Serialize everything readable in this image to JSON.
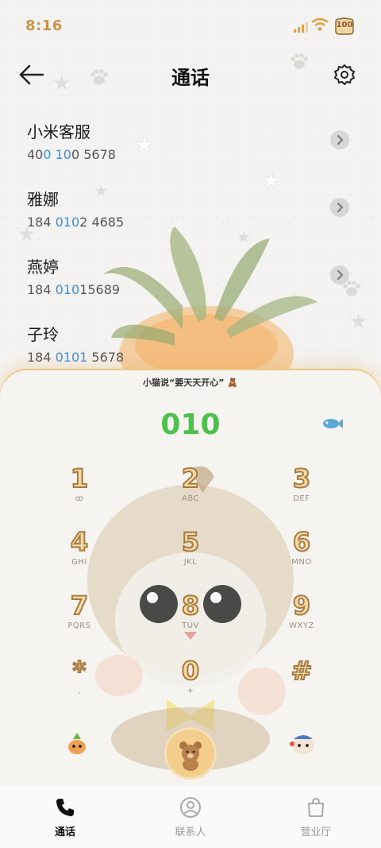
{
  "status_bar": {
    "time": "8:16",
    "battery": "100"
  },
  "header": {
    "title": "通话"
  },
  "contacts": [
    {
      "name": "小米客服",
      "num_a": "40",
      "num_hl": "0 10",
      "num_b": "0 5678"
    },
    {
      "name": "雅娜",
      "num_a": "184 ",
      "num_hl": "010",
      "num_b": "2 4685"
    },
    {
      "name": "燕婷",
      "num_a": "184 ",
      "num_hl": "010",
      "num_b": "15689"
    },
    {
      "name": "子玲",
      "num_a": "184 ",
      "num_hl": "0101",
      "num_b": " 5678"
    }
  ],
  "dialer": {
    "banner": "小猫说“要天天开心”",
    "number": "010",
    "keys": [
      {
        "digit": "1",
        "letters": "ꝏ"
      },
      {
        "digit": "2",
        "letters": "ABC"
      },
      {
        "digit": "3",
        "letters": "DEF"
      },
      {
        "digit": "4",
        "letters": "GHI"
      },
      {
        "digit": "5",
        "letters": "JKL"
      },
      {
        "digit": "6",
        "letters": "MNO"
      },
      {
        "digit": "7",
        "letters": "PQRS"
      },
      {
        "digit": "8",
        "letters": "TUV"
      },
      {
        "digit": "9",
        "letters": "WXYZ"
      },
      {
        "digit": "*",
        "letters": ","
      },
      {
        "digit": "0",
        "letters": "+"
      },
      {
        "digit": "#",
        "letters": ""
      }
    ]
  },
  "nav": {
    "calls": "通话",
    "contacts": "联系人",
    "store": "营业厅"
  },
  "colors": {
    "accent_green": "#4cc24c",
    "highlight_blue": "#3a8ee6",
    "time_gold": "#c9954e"
  },
  "icons": [
    "back-arrow-icon",
    "gear-icon",
    "chevron-right-icon",
    "phone-icon",
    "person-icon",
    "bag-icon",
    "bear-icon",
    "fish-icon"
  ]
}
